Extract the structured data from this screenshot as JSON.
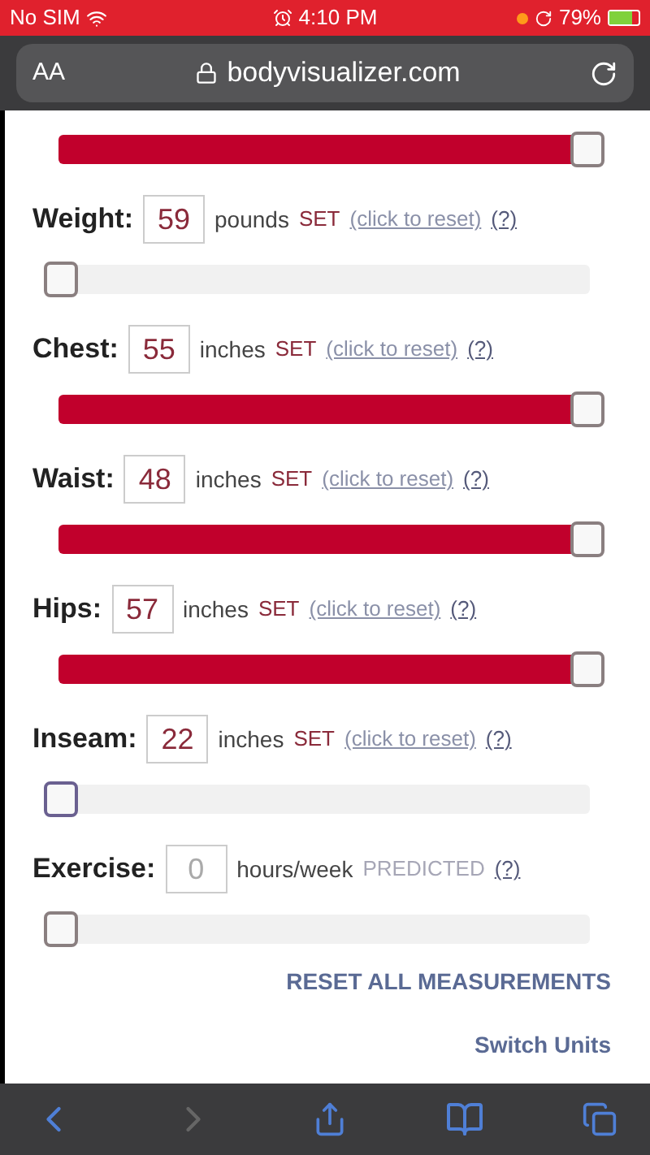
{
  "status_bar": {
    "carrier": "No SIM",
    "time": "4:10 PM",
    "battery": "79%"
  },
  "address_bar": {
    "text_size": "AA",
    "url": "bodyvisualizer.com"
  },
  "top_slider": {
    "level": 1
  },
  "measurements": [
    {
      "label": "Weight:",
      "value": "59",
      "unit": "pounds",
      "status": "SET",
      "kind": "set",
      "reset": "(click to reset)",
      "help": "(?)",
      "level": 0,
      "focused": false
    },
    {
      "label": "Chest:",
      "value": "55",
      "unit": "inches",
      "status": "SET",
      "kind": "set",
      "reset": "(click to reset)",
      "help": "(?)",
      "level": 1,
      "focused": false
    },
    {
      "label": "Waist:",
      "value": "48",
      "unit": "inches",
      "status": "SET",
      "kind": "set",
      "reset": "(click to reset)",
      "help": "(?)",
      "level": 1,
      "focused": false
    },
    {
      "label": "Hips:",
      "value": "57",
      "unit": "inches",
      "status": "SET",
      "kind": "set",
      "reset": "(click to reset)",
      "help": "(?)",
      "level": 1,
      "focused": false
    },
    {
      "label": "Inseam:",
      "value": "22",
      "unit": "inches",
      "status": "SET",
      "kind": "set",
      "reset": "(click to reset)",
      "help": "(?)",
      "level": 0,
      "focused": true
    },
    {
      "label": "Exercise:",
      "value": "0",
      "unit": "hours/week",
      "status": "PREDICTED",
      "kind": "predicted",
      "help": "(?)",
      "level": 0,
      "focused": false
    }
  ],
  "reset_all": "RESET ALL MEASUREMENTS",
  "switch_units": "Switch Units"
}
